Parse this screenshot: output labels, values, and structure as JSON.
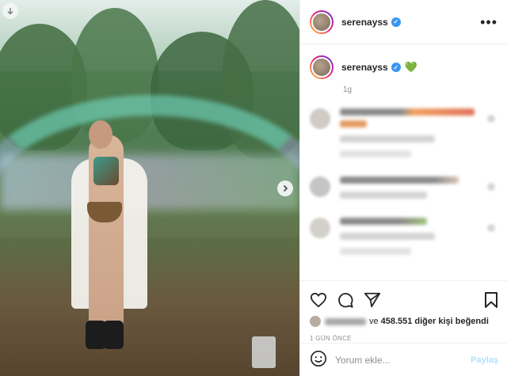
{
  "post": {
    "username": "serenayss",
    "caption_emoji": "💚",
    "caption_time": "1g",
    "likes_and": "ve",
    "likes_count": "458.551",
    "likes_suffix": "diğer kişi beğendi",
    "posted_ago": "1 GÜN ÖNCE"
  },
  "comment_input": {
    "placeholder": "Yorum ekle...",
    "post_label": "Paylaş"
  },
  "icons": {
    "back": "arrow-down-circle-icon",
    "next": "chevron-right-icon",
    "more": "more-options-icon",
    "verified": "verified-badge-icon",
    "like": "heart-icon",
    "comment": "comment-icon",
    "share": "paper-plane-icon",
    "save": "bookmark-icon",
    "emoji": "emoji-icon"
  },
  "colors": {
    "verified": "#3897f0",
    "post_button_disabled": "#b2dffc",
    "heart_emoji": "#2db34a"
  }
}
